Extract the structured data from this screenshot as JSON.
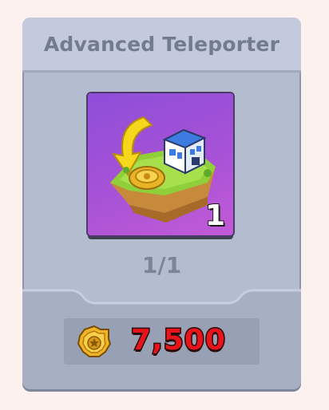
{
  "item": {
    "title": "Advanced Teleporter",
    "level_badge": "1",
    "owned_progress": "1/1",
    "price": "7,500",
    "icon": "teleporter-island-icon",
    "currency_icon": "gold-badge-coin-icon"
  },
  "colors": {
    "card_bg": "#b4bccf",
    "title_bg": "#c3cadb",
    "tile_purple": "#a652d6",
    "price_red": "#e8141b",
    "coin_gold": "#f0b429"
  }
}
